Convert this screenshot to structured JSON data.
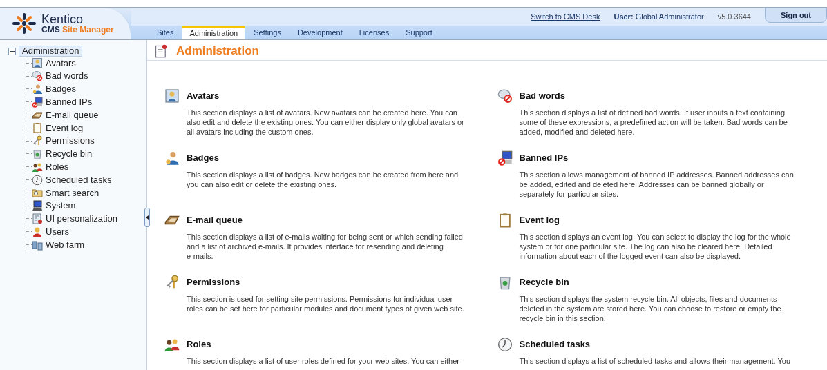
{
  "logo": {
    "brand": "Kentico",
    "product_prefix": "CMS",
    "product_name": "Site Manager"
  },
  "top_bar": {
    "switch_link": "Switch to CMS Desk",
    "user_label": "User:",
    "user_name": "Global Administrator",
    "version": "v5.0.3644",
    "sign_out": "Sign out"
  },
  "tabs": [
    {
      "label": "Sites",
      "selected": false
    },
    {
      "label": "Administration",
      "selected": true
    },
    {
      "label": "Settings",
      "selected": false
    },
    {
      "label": "Development",
      "selected": false
    },
    {
      "label": "Licenses",
      "selected": false
    },
    {
      "label": "Support",
      "selected": false
    }
  ],
  "tree": {
    "label": "Administration",
    "expanded": true,
    "selected": true,
    "children": [
      {
        "label": "Avatars",
        "selected": false
      },
      {
        "label": "Bad words",
        "selected": false
      },
      {
        "label": "Badges",
        "selected": false
      },
      {
        "label": "Banned IPs",
        "selected": false
      },
      {
        "label": "E-mail queue",
        "selected": false
      },
      {
        "label": "Event log",
        "selected": false
      },
      {
        "label": "Permissions",
        "selected": false
      },
      {
        "label": "Recycle bin",
        "selected": false
      },
      {
        "label": "Roles",
        "selected": false
      },
      {
        "label": "Scheduled tasks",
        "selected": false
      },
      {
        "label": "Smart search",
        "selected": false
      },
      {
        "label": "System",
        "selected": false
      },
      {
        "label": "UI personalization",
        "selected": false
      },
      {
        "label": "Users",
        "selected": false
      },
      {
        "label": "Web farm",
        "selected": false
      }
    ]
  },
  "page_title": "Administration",
  "sections": [
    {
      "title": "Avatars",
      "description": [
        "This section displays a list of avatars. New avatars can be created here. You can",
        "also edit and delete the existing ones. You can either display only global avatars or",
        "all avatars including the custom ones."
      ]
    },
    {
      "title": "Bad words",
      "description": [
        "This section displays a list of defined bad words. If user inputs a text containing",
        "some of these expressions, a predefined action will be taken. Bad words can be",
        "added, modified and deleted here."
      ]
    },
    {
      "title": "Badges",
      "description": [
        "This section displays a list of badges. New badges can be created from here and",
        "you can also edit or delete the existing ones."
      ]
    },
    {
      "title": "Banned IPs",
      "description": [
        "This section allows management of banned IP addresses. Banned addresses can",
        "be added, edited and deleted here. Addresses can be banned globally or",
        "separately for particular sites."
      ]
    },
    {
      "title": "E-mail queue",
      "description": [
        "This section displays a list of e-mails waiting for being sent or which sending failed",
        "and a list of archived e-mails. It provides interface for resending and deleting",
        "e-mails."
      ]
    },
    {
      "title": "Event log",
      "description": [
        "This section displays an event log. You can select to display the log for the whole",
        "system or for one particular site. The log can also be cleared here. Detailed",
        "information about each of the logged event can also be displayed."
      ]
    },
    {
      "title": "Permissions",
      "description": [
        "This section is used for setting site permissions. Permissions for individual user",
        "roles can be set here for particular modules and document types of given web site."
      ]
    },
    {
      "title": "Recycle bin",
      "description": [
        "This section displays the system recycle bin. All objects, files and documents",
        "deleted in the system are stored here. You can choose to restore or empty the",
        "recycle bin in this section."
      ]
    },
    {
      "title": "Roles",
      "description": [
        "This section displays a list of user roles defined for your web sites. You can either"
      ]
    },
    {
      "title": "Scheduled tasks",
      "description": [
        "This section displays a list of scheduled tasks and allows their management. You"
      ]
    }
  ]
}
